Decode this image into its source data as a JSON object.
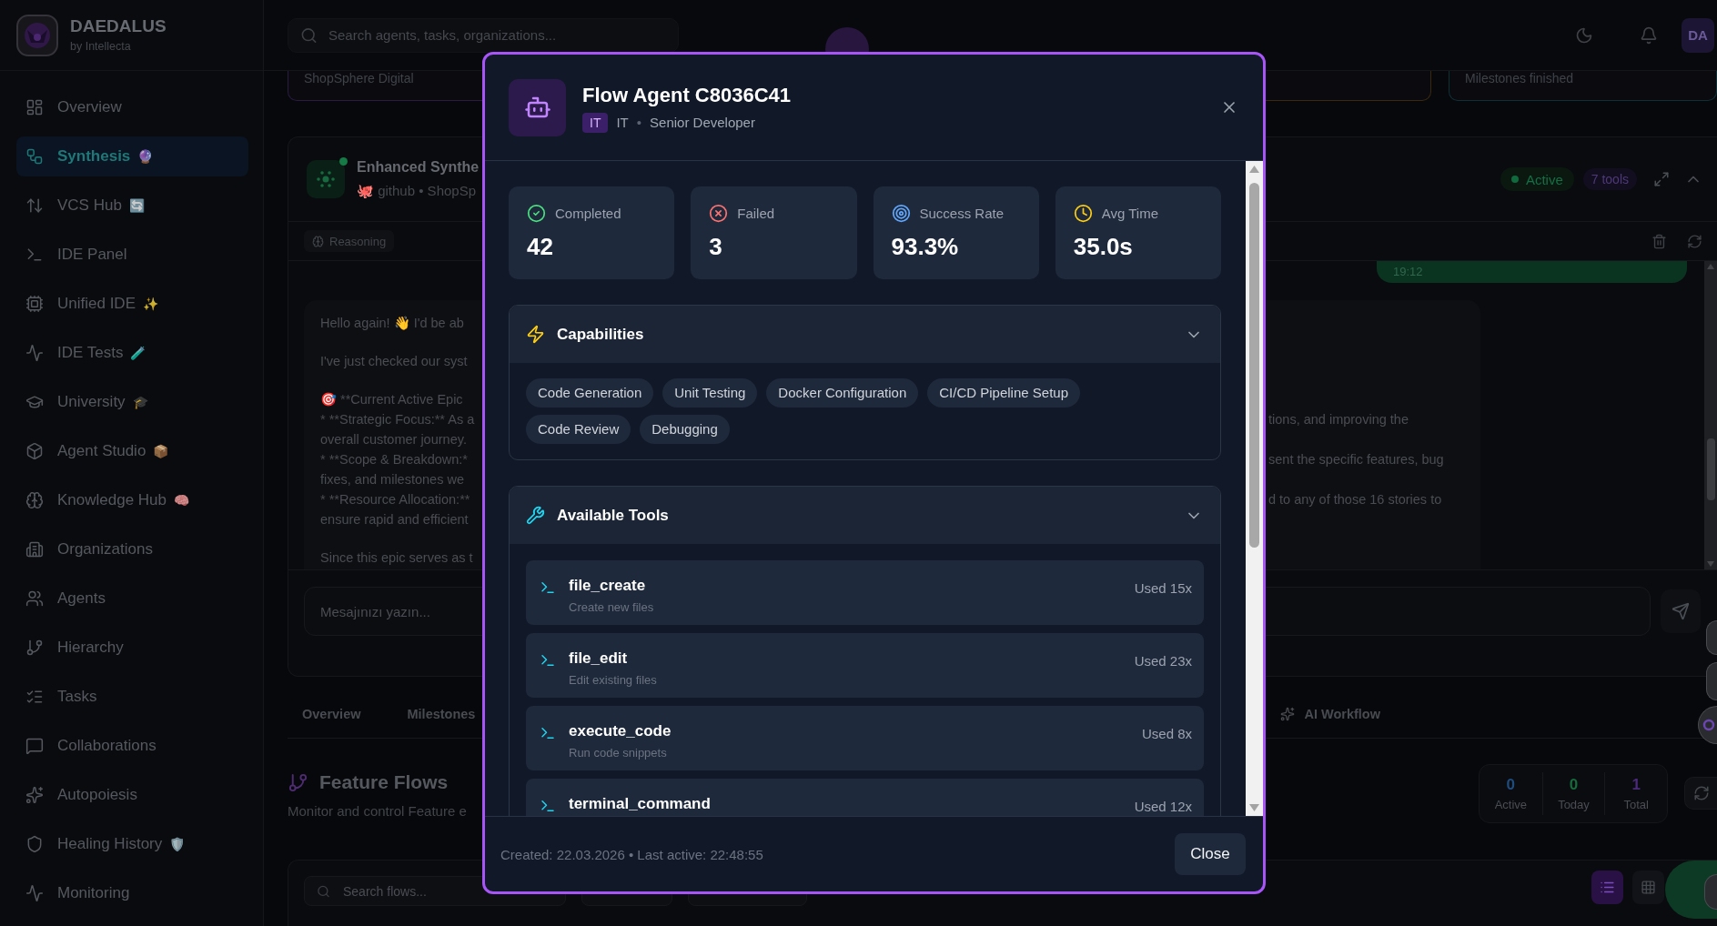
{
  "brand": {
    "name": "DAEDALUS",
    "tagline": "by Intellecta"
  },
  "sidebar": {
    "items": [
      {
        "label": "Overview",
        "selected": false
      },
      {
        "label": "Synthesis",
        "emoji": "🔮",
        "selected": true
      },
      {
        "label": "VCS Hub",
        "emoji": "🔄",
        "selected": false
      },
      {
        "label": "IDE Panel",
        "selected": false
      },
      {
        "label": "Unified IDE",
        "emoji": "✨",
        "selected": false
      },
      {
        "label": "IDE Tests",
        "emoji": "🧪",
        "selected": false
      },
      {
        "label": "University",
        "emoji": "🎓",
        "selected": false
      },
      {
        "label": "Agent Studio",
        "emoji": "📦",
        "selected": false
      },
      {
        "label": "Knowledge Hub",
        "emoji": "🧠",
        "selected": false
      },
      {
        "label": "Organizations",
        "selected": false
      },
      {
        "label": "Agents",
        "selected": false
      },
      {
        "label": "Hierarchy",
        "selected": false
      },
      {
        "label": "Tasks",
        "selected": false
      },
      {
        "label": "Collaborations",
        "selected": false
      },
      {
        "label": "Autopoiesis",
        "selected": false
      },
      {
        "label": "Healing History",
        "emoji": "🛡️",
        "selected": false
      },
      {
        "label": "Monitoring",
        "selected": false
      }
    ]
  },
  "topbar": {
    "search": {
      "placeholder": "Search agents, tasks, organizations..."
    },
    "avatar": "DA"
  },
  "summary_cards": [
    {
      "caption": "ShopSphere Digital",
      "color": "#2a1a44"
    },
    {
      "color": "#3a2810"
    },
    {
      "caption": "Milestones finished",
      "color": "#103038"
    }
  ],
  "session": {
    "title": "Enhanced Synthe",
    "subtitle": "🐙 github • ShopSp",
    "status": "Active",
    "tool_count": "7 tools",
    "mode": "Reasoning",
    "messages": [
      {
        "kind": "user",
        "time": "19:12"
      },
      {
        "kind": "assistant",
        "paragraphs": [
          [
            {
              "left": "Hello again! 👋 I'd be ab"
            }
          ],
          [
            {
              "left": "I've just checked our syst"
            }
          ],
          [
            {
              "left": "🎯 **Current Active Epic"
            },
            {
              "left": "* **Strategic Focus:** As a",
              "right": "tions, and improving the"
            },
            {
              "left": "overall customer journey."
            },
            {
              "left": "* **Scope & Breakdown:*",
              "right": "sent the specific features, bug"
            },
            {
              "left": "fixes, and milestones we"
            },
            {
              "left": "* **Resource Allocation:**",
              "right": "d to any of those 16 stories to"
            },
            {
              "left": "ensure rapid and efficient"
            }
          ],
          [
            {
              "left": "Since this epic serves as t"
            }
          ]
        ]
      }
    ],
    "input": {
      "placeholder": "Mesajınızı yazın..."
    }
  },
  "tabs": [
    {
      "label": "Overview",
      "kind": "plain",
      "selected": false
    },
    {
      "label": "Milestones",
      "kind": "plain",
      "selected": false
    },
    {
      "label": "AI Workflow",
      "kind": "ai",
      "selected": false
    }
  ],
  "feature_flows": {
    "title": "Feature Flows",
    "subtitle": "Monitor and control Feature e",
    "counters": [
      {
        "value": "0",
        "label": "Active",
        "color": "#1e4d7d"
      },
      {
        "value": "0",
        "label": "Today",
        "color": "#166a3c"
      },
      {
        "value": "1",
        "label": "Total",
        "color": "#4b2a7a"
      }
    ],
    "search": {
      "placeholder": "Search flows..."
    },
    "view_modes": [
      {
        "selected": true
      },
      {
        "selected": false
      }
    ]
  },
  "agent_modal": {
    "title": "Flow Agent C8036C41",
    "badge": "IT",
    "department": "IT",
    "separator": "•",
    "role": "Senior Developer",
    "stats": [
      {
        "kind": "completed",
        "label": "Completed",
        "value": "42"
      },
      {
        "kind": "failed",
        "label": "Failed",
        "value": "3"
      },
      {
        "kind": "success_rate",
        "label": "Success Rate",
        "value": "93.3%"
      },
      {
        "kind": "avg_time",
        "label": "Avg Time",
        "value": "35.0s"
      }
    ],
    "capabilities": {
      "title": "Capabilities",
      "expanded": true,
      "items": [
        "Code Generation",
        "Unit Testing",
        "Docker Configuration",
        "CI/CD Pipeline Setup",
        "Code Review",
        "Debugging"
      ]
    },
    "tools": {
      "title": "Available Tools",
      "expanded": true,
      "items": [
        {
          "name": "file_create",
          "description": "Create new files",
          "usage": "Used 15x"
        },
        {
          "name": "file_edit",
          "description": "Edit existing files",
          "usage": "Used 23x"
        },
        {
          "name": "execute_code",
          "description": "Run code snippets",
          "usage": "Used 8x"
        },
        {
          "name": "terminal_command",
          "usage": "Used 12x"
        }
      ]
    },
    "footer": "Created: 22.03.2026 • Last active: 22:48:55",
    "close_label": "Close"
  }
}
